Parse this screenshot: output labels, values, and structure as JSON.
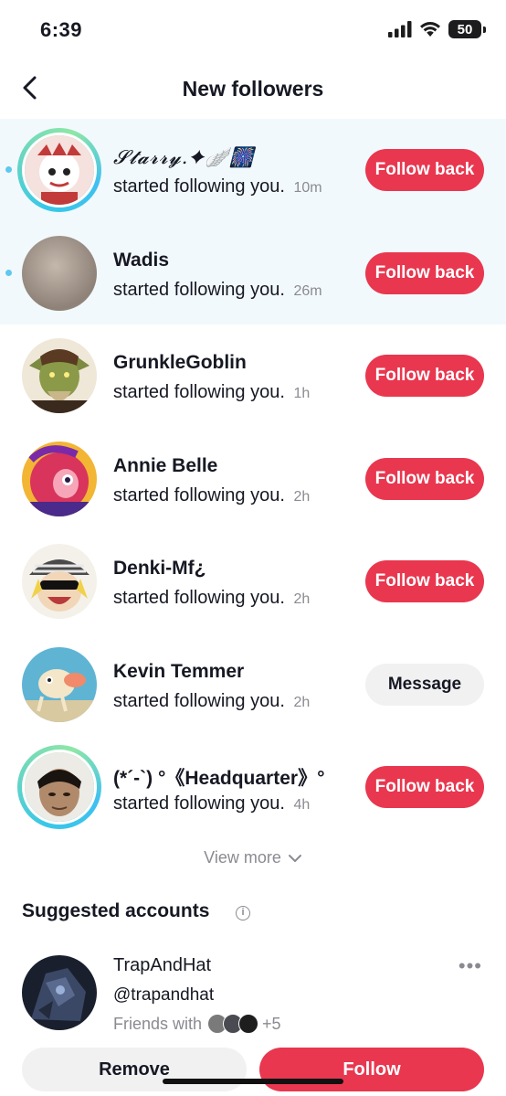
{
  "status_bar": {
    "time": "6:39",
    "battery": "50"
  },
  "header": {
    "title": "New followers"
  },
  "followers": [
    {
      "name": "𝓢𝓽𝓪𝓻𝓻𝔂.✦🪽🎆",
      "subtitle": "started following you.",
      "time": "10m",
      "button": "Follow back",
      "unread": true,
      "story": true,
      "avatar_color": "#c24646"
    },
    {
      "name": "Wadis",
      "subtitle": "started following you.",
      "time": "26m",
      "button": "Follow back",
      "unread": true,
      "story": false,
      "avatar_color": "#a89a8e"
    },
    {
      "name": "GrunkleGoblin",
      "subtitle": "started following you.",
      "time": "1h",
      "button": "Follow back",
      "unread": false,
      "story": false,
      "avatar_color": "#6b7a3a"
    },
    {
      "name": "Annie Belle",
      "subtitle": "started following you.",
      "time": "2h",
      "button": "Follow back",
      "unread": false,
      "story": false,
      "avatar_color": "#d64a6a"
    },
    {
      "name": "Denki-Mf¿",
      "subtitle": "started following you.",
      "time": "2h",
      "button": "Follow back",
      "unread": false,
      "story": false,
      "avatar_color": "#e6c04a"
    },
    {
      "name": "Kevin Temmer",
      "subtitle": "started following you.",
      "time": "2h",
      "button": "Message",
      "unread": false,
      "story": false,
      "avatar_color": "#5fb4d4"
    },
    {
      "name": "(*´-`) °《Headquarter》°",
      "subtitle": "started following you.",
      "time": "4h",
      "button": "Follow back",
      "unread": false,
      "story": true,
      "avatar_color": "#6a5a4a"
    }
  ],
  "view_more": "View more",
  "suggested": {
    "title": "Suggested accounts",
    "account": {
      "name": "TrapAndHat",
      "handle": "@trapandhat",
      "friends_label": "Friends with",
      "friends_more": "+5"
    },
    "remove_label": "Remove",
    "follow_label": "Follow"
  },
  "colors": {
    "accent": "#e8374f",
    "unread_bg": "#f2f9fc",
    "unread_dot": "#5ec8ee"
  }
}
